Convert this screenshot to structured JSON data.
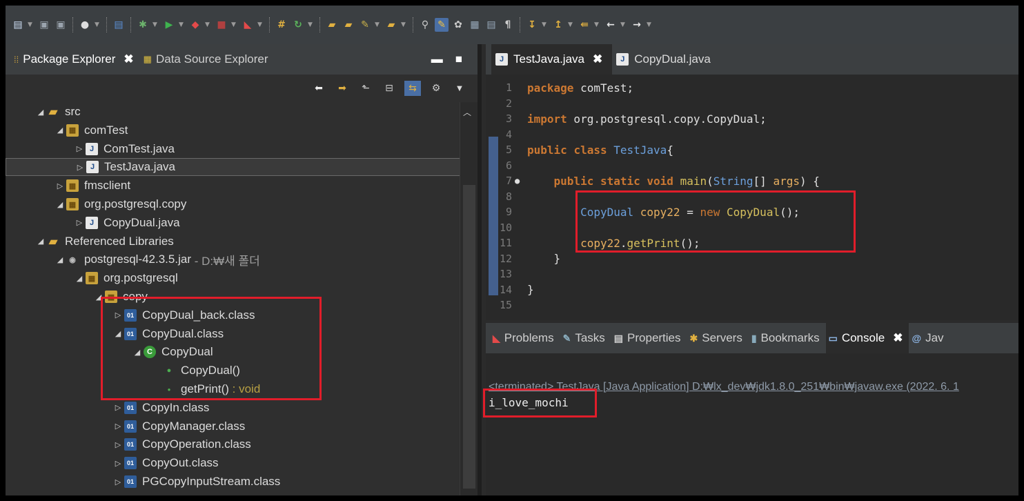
{
  "colors": {
    "highlight_box": "#e11d2a",
    "keyword": "#cc7832",
    "type": "#6ca0dc"
  },
  "toolbar": {
    "icons": [
      "new-icon",
      "save-icon",
      "save-all-icon",
      "debug-icon",
      "run-icon",
      "stop-icon",
      "build-icon",
      "refresh-icon",
      "open-folder-icon",
      "brush-icon",
      "search-icon",
      "pin-icon",
      "editor-icon",
      "back-icon",
      "forward-icon"
    ]
  },
  "left_panel": {
    "tabs": [
      {
        "label": "Package Explorer",
        "active": true
      },
      {
        "label": "Data Source Explorer",
        "active": false
      }
    ],
    "tree": [
      {
        "label": "src",
        "arrow": "◢",
        "icon": "src-folder-icon",
        "level": 0
      },
      {
        "label": "comTest",
        "arrow": "◢",
        "icon": "package-icon",
        "level": 1
      },
      {
        "label": "ComTest.java",
        "arrow": "▷",
        "icon": "java-file-icon",
        "level": 2
      },
      {
        "label": "TestJava.java",
        "arrow": "▷",
        "icon": "java-file-icon",
        "level": 2,
        "selected": true
      },
      {
        "label": "fmsclient",
        "arrow": "▷",
        "icon": "package-icon",
        "level": 1
      },
      {
        "label": "org.postgresql.copy",
        "arrow": "◢",
        "icon": "package-icon",
        "level": 1
      },
      {
        "label": "CopyDual.java",
        "arrow": "▷",
        "icon": "java-file-icon",
        "level": 2
      },
      {
        "label": "Referenced Libraries",
        "arrow": "◢",
        "icon": "library-icon",
        "level": 0
      },
      {
        "label": "postgresql-42.3.5.jar",
        "suffix": " - D:₩새 폴더",
        "arrow": "◢",
        "icon": "jar-icon",
        "level": 1
      },
      {
        "label": "org.postgresql",
        "arrow": "◢",
        "icon": "package-icon",
        "level": 2
      },
      {
        "label": "copy",
        "arrow": "◢",
        "icon": "package-icon",
        "level": 3
      },
      {
        "label": "CopyDual_back.class",
        "arrow": "▷",
        "icon": "class-file-icon",
        "level": 4
      },
      {
        "label": "CopyDual.class",
        "arrow": "◢",
        "icon": "class-file-icon",
        "level": 4
      },
      {
        "label": "CopyDual",
        "arrow": "◢",
        "icon": "class-icon",
        "level": 5
      },
      {
        "label": "CopyDual()",
        "arrow": "",
        "icon": "constructor-icon",
        "level": 6
      },
      {
        "label": "getPrint()",
        "suffix": " : void",
        "arrow": "",
        "icon": "method-icon",
        "level": 6
      },
      {
        "label": "CopyIn.class",
        "arrow": "▷",
        "icon": "class-file-icon",
        "level": 4
      },
      {
        "label": "CopyManager.class",
        "arrow": "▷",
        "icon": "class-file-icon",
        "level": 4
      },
      {
        "label": "CopyOperation.class",
        "arrow": "▷",
        "icon": "class-file-icon",
        "level": 4
      },
      {
        "label": "CopyOut.class",
        "arrow": "▷",
        "icon": "class-file-icon",
        "level": 4
      },
      {
        "label": "PGCopyInputStream.class",
        "arrow": "▷",
        "icon": "class-file-icon",
        "level": 4
      }
    ]
  },
  "editor": {
    "tabs": [
      {
        "label": "TestJava.java",
        "active": true
      },
      {
        "label": "CopyDual.java",
        "active": false
      }
    ],
    "lines": [
      {
        "n": "1",
        "tokens": [
          {
            "t": "package",
            "c": "kw"
          },
          {
            "t": " comTest;",
            "c": "pl"
          }
        ]
      },
      {
        "n": "2",
        "tokens": []
      },
      {
        "n": "3",
        "tokens": [
          {
            "t": "import",
            "c": "kw"
          },
          {
            "t": " org.postgresql.copy.CopyDual;",
            "c": "pl"
          }
        ]
      },
      {
        "n": "4",
        "tokens": []
      },
      {
        "n": "5",
        "tokens": [
          {
            "t": "public",
            "c": "kw"
          },
          {
            "t": " ",
            "c": "pl"
          },
          {
            "t": "class",
            "c": "kw"
          },
          {
            "t": " ",
            "c": "pl"
          },
          {
            "t": "TestJava",
            "c": "ty"
          },
          {
            "t": "{",
            "c": "pl"
          }
        ]
      },
      {
        "n": "6",
        "tokens": []
      },
      {
        "n": "7",
        "tokens": [
          {
            "t": "    ",
            "c": "pl"
          },
          {
            "t": "public",
            "c": "kw"
          },
          {
            "t": " ",
            "c": "pl"
          },
          {
            "t": "static",
            "c": "kw"
          },
          {
            "t": " ",
            "c": "pl"
          },
          {
            "t": "void",
            "c": "kw"
          },
          {
            "t": " ",
            "c": "pl"
          },
          {
            "t": "main",
            "c": "fn"
          },
          {
            "t": "(",
            "c": "pl"
          },
          {
            "t": "String",
            "c": "ty"
          },
          {
            "t": "[] ",
            "c": "pl"
          },
          {
            "t": "args",
            "c": "vr"
          },
          {
            "t": ") {",
            "c": "pl"
          }
        ]
      },
      {
        "n": "8",
        "tokens": []
      },
      {
        "n": "9",
        "tokens": [
          {
            "t": "        ",
            "c": "pl"
          },
          {
            "t": "CopyDual",
            "c": "ty"
          },
          {
            "t": " ",
            "c": "pl"
          },
          {
            "t": "copy22",
            "c": "vr"
          },
          {
            "t": " = ",
            "c": "pl"
          },
          {
            "t": "new",
            "c": "kw2"
          },
          {
            "t": " ",
            "c": "pl"
          },
          {
            "t": "CopyDual",
            "c": "fn"
          },
          {
            "t": "();",
            "c": "pl"
          }
        ]
      },
      {
        "n": "10",
        "tokens": []
      },
      {
        "n": "11",
        "tokens": [
          {
            "t": "        ",
            "c": "pl"
          },
          {
            "t": "copy22",
            "c": "vr"
          },
          {
            "t": ".",
            "c": "pl"
          },
          {
            "t": "getPrint",
            "c": "fn"
          },
          {
            "t": "();",
            "c": "pl"
          }
        ]
      },
      {
        "n": "12",
        "tokens": [
          {
            "t": "    }",
            "c": "pl"
          }
        ]
      },
      {
        "n": "13",
        "tokens": []
      },
      {
        "n": "14",
        "tokens": [
          {
            "t": "}",
            "c": "pl"
          }
        ]
      },
      {
        "n": "15",
        "tokens": []
      }
    ]
  },
  "console_panel": {
    "tabs": [
      {
        "label": "Problems",
        "icon": "problems-icon"
      },
      {
        "label": "Tasks",
        "icon": "tasks-icon"
      },
      {
        "label": "Properties",
        "icon": "properties-icon"
      },
      {
        "label": "Servers",
        "icon": "servers-icon"
      },
      {
        "label": "Bookmarks",
        "icon": "bookmarks-icon"
      },
      {
        "label": "Console",
        "icon": "console-icon",
        "active": true
      },
      {
        "label": "Jav",
        "icon": "javadoc-icon"
      }
    ],
    "terminated": "<terminated> TestJava [Java Application] D:₩lx_dev₩jdk1.8.0_251₩bin₩javaw.exe (2022. 6. 1",
    "output": "i_love_mochi"
  }
}
